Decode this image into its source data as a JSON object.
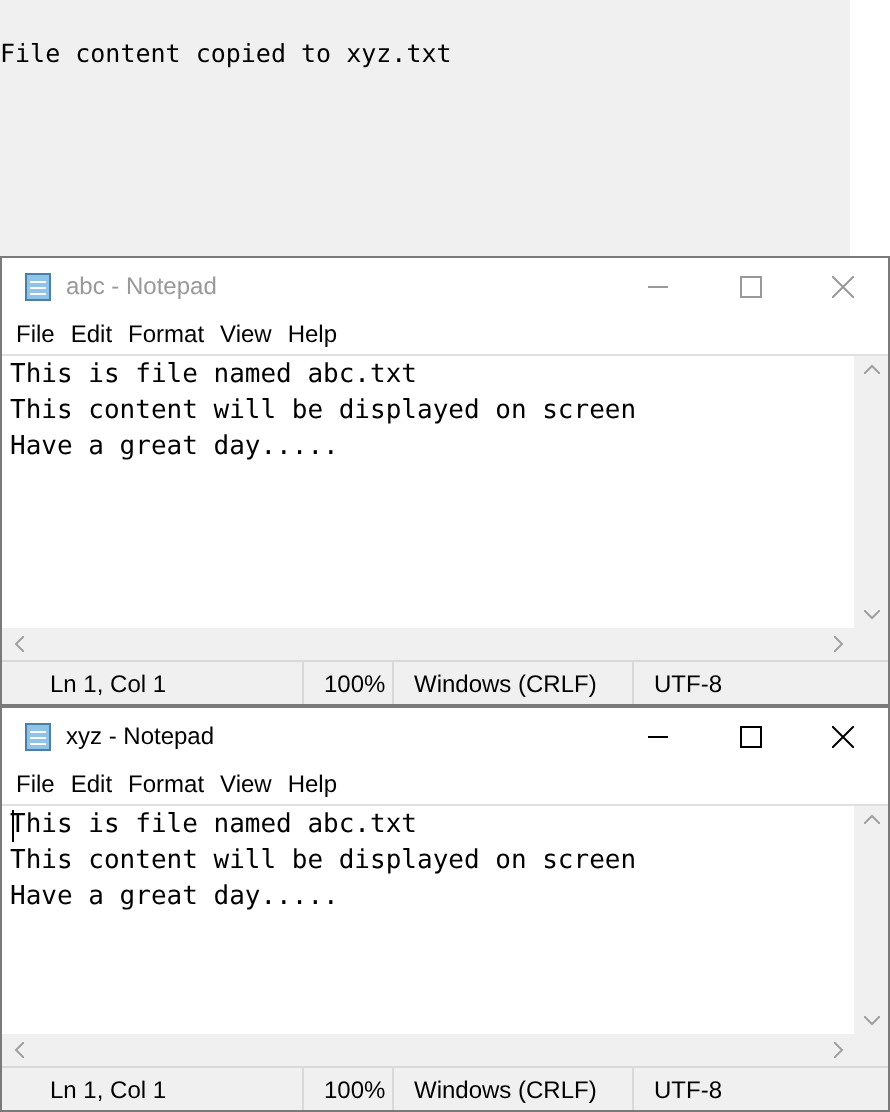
{
  "console": {
    "output": "File content copied to xyz.txt"
  },
  "windows": [
    {
      "title": "abc - Notepad",
      "active": false,
      "cursor": false,
      "menu": [
        "File",
        "Edit",
        "Format",
        "View",
        "Help"
      ],
      "lines": [
        "This is file named abc.txt",
        "This content will be displayed on screen",
        "Have a great day....."
      ],
      "status": [
        "Ln 1, Col 1",
        "100%",
        "Windows (CRLF)",
        "UTF-8"
      ]
    },
    {
      "title": "xyz - Notepad",
      "active": true,
      "cursor": true,
      "menu": [
        "File",
        "Edit",
        "Format",
        "View",
        "Help"
      ],
      "lines": [
        "This is file named abc.txt",
        "This content will be displayed on screen",
        "Have a great day....."
      ],
      "status": [
        "Ln 1, Col 1",
        "100%",
        "Windows (CRLF)",
        "UTF-8"
      ]
    }
  ]
}
